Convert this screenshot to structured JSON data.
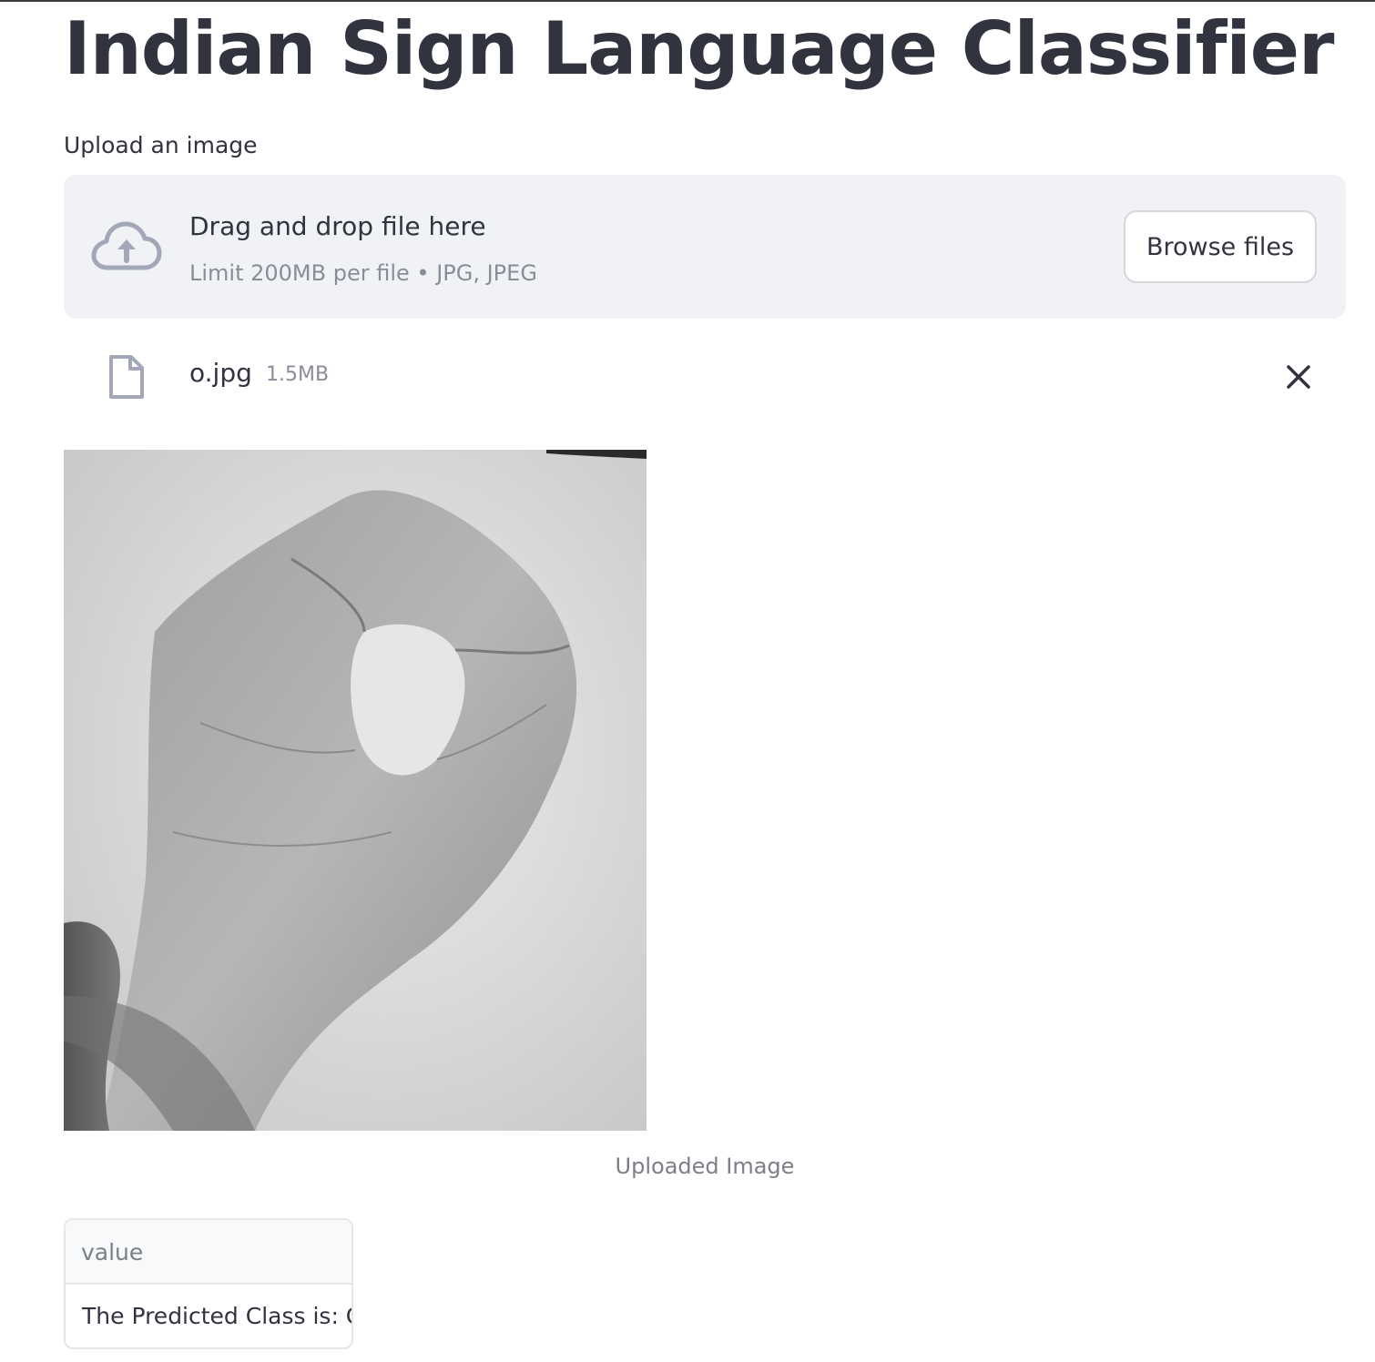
{
  "app": {
    "title": "Indian Sign Language Classifier"
  },
  "uploader": {
    "label": "Upload an image",
    "drop_text": "Drag and drop file here",
    "limit_text": "Limit 200MB per file • JPG, JPEG",
    "browse_label": "Browse files",
    "icon": "cloud-upload-icon"
  },
  "uploaded_file": {
    "name": "o.jpg",
    "size": "1.5MB",
    "icon": "file-icon",
    "remove_icon": "close-icon"
  },
  "image": {
    "caption": "Uploaded Image"
  },
  "result_table": {
    "header": "value",
    "rows": [
      "The Predicted Class is: C"
    ]
  },
  "colors": {
    "text": "#31333f",
    "muted": "#8a8d99",
    "dropzone_bg": "#f0f2f6",
    "icon": "#a3a8b8"
  }
}
